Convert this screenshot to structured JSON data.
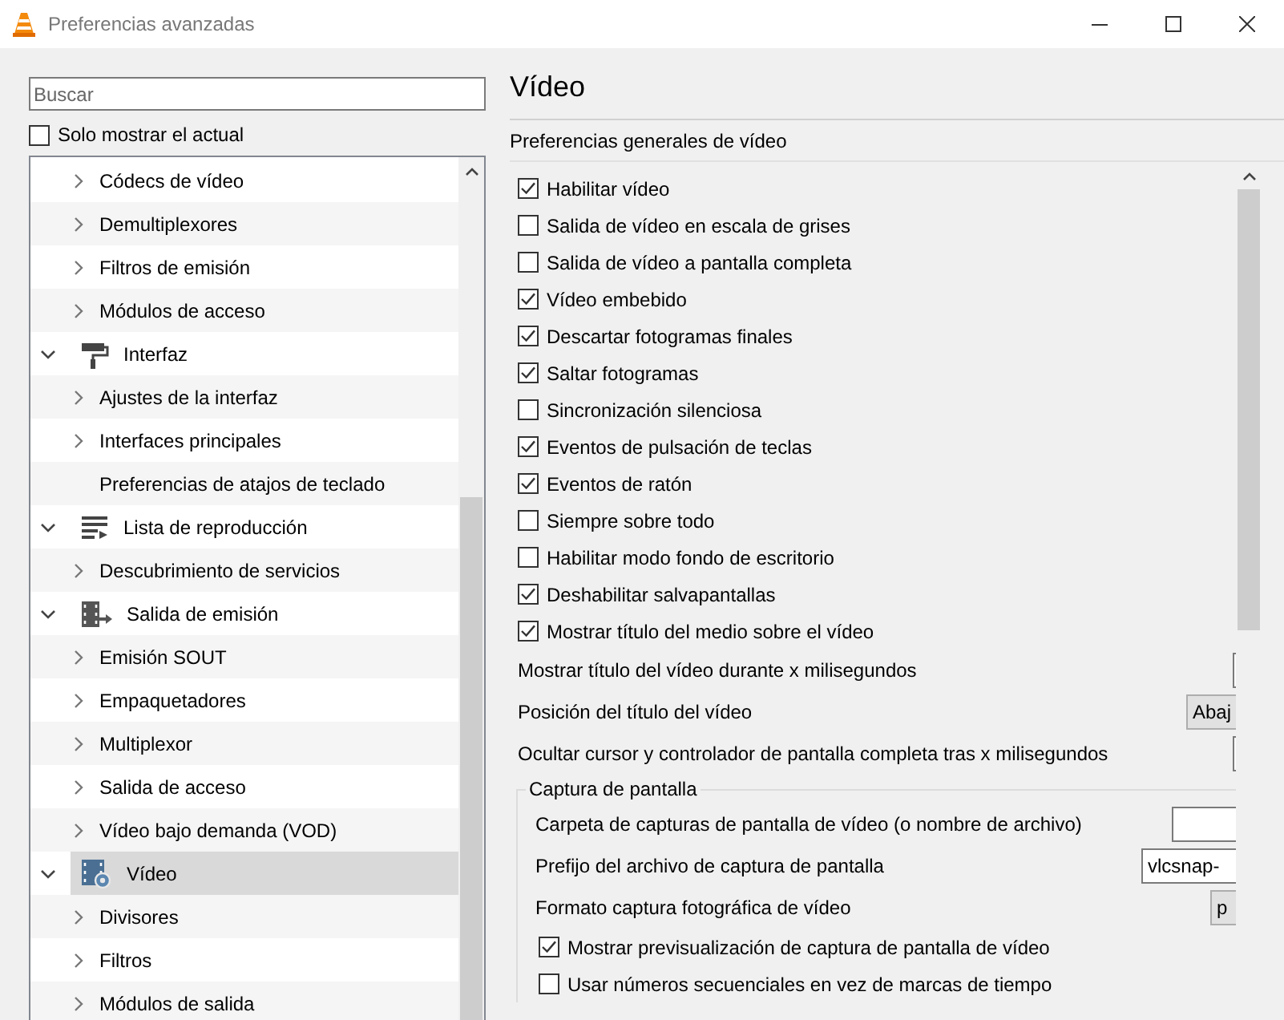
{
  "window": {
    "title": "Preferencias avanzadas"
  },
  "search": {
    "placeholder": "Buscar"
  },
  "only_current": {
    "label": "Solo mostrar el actual",
    "checked": false
  },
  "tree": [
    {
      "children": [
        {
          "label": "Códecs de vídeo",
          "has_children": true,
          "selected": false
        },
        {
          "label": "Demultiplexores",
          "has_children": true,
          "selected": false
        },
        {
          "label": "Filtros de emisión",
          "has_children": true,
          "selected": false
        },
        {
          "label": "Módulos de acceso",
          "has_children": true,
          "selected": false
        }
      ]
    },
    {
      "label": "Interfaz",
      "kind": "interface",
      "expanded": true,
      "selected": false,
      "children": [
        {
          "label": "Ajustes de la interfaz",
          "has_children": true,
          "selected": false
        },
        {
          "label": "Interfaces principales",
          "has_children": true,
          "selected": false
        },
        {
          "label": "Preferencias de atajos de teclado",
          "has_children": false,
          "selected": false
        }
      ]
    },
    {
      "label": "Lista de reproducción",
      "kind": "playlist",
      "expanded": true,
      "selected": false,
      "children": [
        {
          "label": "Descubrimiento de servicios",
          "has_children": true,
          "selected": false
        }
      ]
    },
    {
      "label": "Salida de emisión",
      "kind": "stream",
      "expanded": true,
      "selected": false,
      "children": [
        {
          "label": "Emisión SOUT",
          "has_children": true,
          "selected": false
        },
        {
          "label": "Empaquetadores",
          "has_children": true,
          "selected": false
        },
        {
          "label": "Multiplexor",
          "has_children": true,
          "selected": false
        },
        {
          "label": "Salida de acceso",
          "has_children": true,
          "selected": false
        },
        {
          "label": "Vídeo bajo demanda (VOD)",
          "has_children": true,
          "selected": false
        }
      ]
    },
    {
      "label": "Vídeo",
      "kind": "video",
      "expanded": true,
      "selected": true,
      "children": [
        {
          "label": "Divisores",
          "has_children": true,
          "selected": false
        },
        {
          "label": "Filtros",
          "has_children": true,
          "selected": false
        },
        {
          "label": "Módulos de salida",
          "has_children": true,
          "selected": false
        }
      ]
    }
  ],
  "panel": {
    "title": "Vídeo",
    "subtitle": "Preferencias generales de vídeo",
    "options": [
      {
        "kind": "checkbox",
        "label": "Habilitar vídeo",
        "checked": true
      },
      {
        "kind": "checkbox",
        "label": "Salida de vídeo en escala de grises",
        "checked": false
      },
      {
        "kind": "checkbox",
        "label": "Salida de vídeo a pantalla completa",
        "checked": false
      },
      {
        "kind": "checkbox",
        "label": "Vídeo embebido",
        "checked": true
      },
      {
        "kind": "checkbox",
        "label": "Descartar fotogramas finales",
        "checked": true
      },
      {
        "kind": "checkbox",
        "label": "Saltar fotogramas",
        "checked": true
      },
      {
        "kind": "checkbox",
        "label": "Sincronización silenciosa",
        "checked": false
      },
      {
        "kind": "checkbox",
        "label": "Eventos de pulsación de teclas",
        "checked": true
      },
      {
        "kind": "checkbox",
        "label": "Eventos de ratón",
        "checked": true
      },
      {
        "kind": "checkbox",
        "label": "Siempre sobre todo",
        "checked": false
      },
      {
        "kind": "checkbox",
        "label": "Habilitar modo fondo de escritorio",
        "checked": false
      },
      {
        "kind": "checkbox",
        "label": "Deshabilitar salvapantallas",
        "checked": true
      },
      {
        "kind": "checkbox",
        "label": "Mostrar título del medio sobre el vídeo",
        "checked": true
      },
      {
        "kind": "spin",
        "label": "Mostrar título del vídeo durante x milisegundos"
      },
      {
        "kind": "select",
        "label": "Posición del título del vídeo",
        "value": "Abaj"
      },
      {
        "kind": "spin",
        "label": "Ocultar cursor y controlador de pantalla completa tras x milisegundos"
      }
    ],
    "group": {
      "title": "Captura de pantalla",
      "options": [
        {
          "kind": "text",
          "label": "Carpeta de capturas de pantalla de vídeo (o nombre de archivo)"
        },
        {
          "kind": "text",
          "label": "Prefijo del archivo de captura de pantalla",
          "value": "vlcsnap-"
        },
        {
          "kind": "select",
          "label": "Formato captura fotográfica de vídeo",
          "value": "p"
        },
        {
          "kind": "checkbox",
          "label": "Mostrar previsualización de captura de pantalla de vídeo",
          "checked": true
        },
        {
          "kind": "checkbox",
          "label": "Usar números secuenciales en vez de marcas de tiempo",
          "checked": false
        }
      ]
    }
  }
}
